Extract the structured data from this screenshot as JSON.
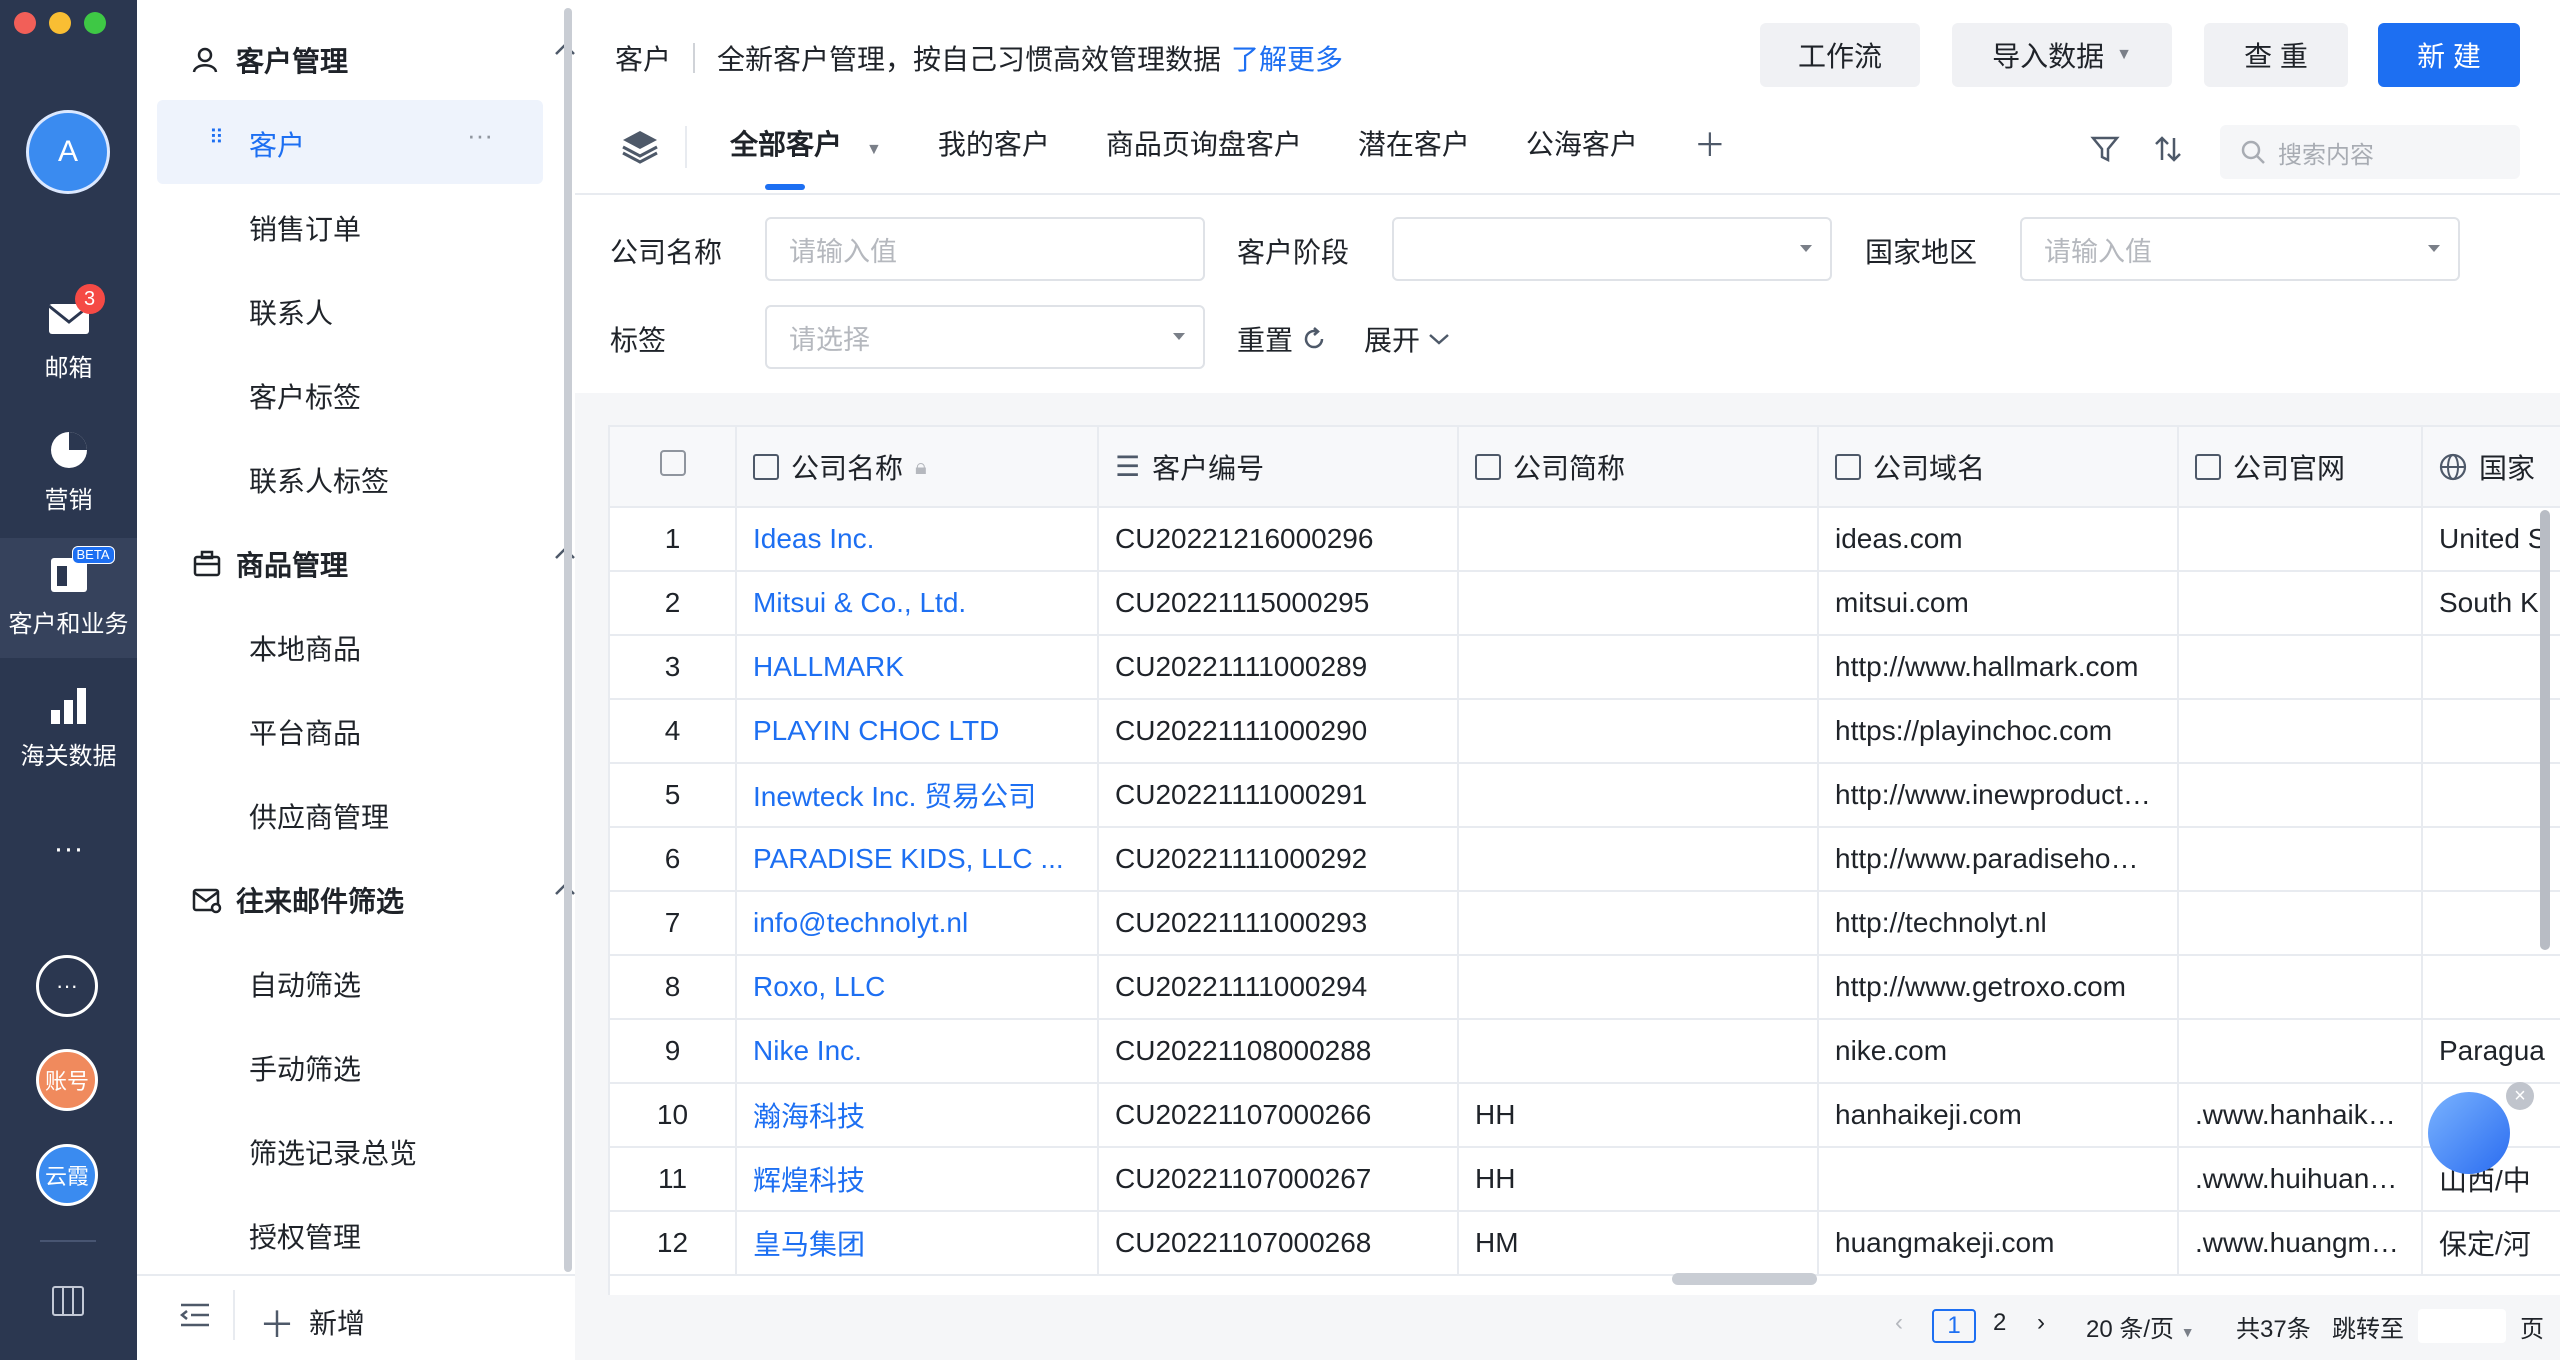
{
  "rail": {
    "avatar": "A",
    "items": [
      {
        "label": "邮箱",
        "badge": "3"
      },
      {
        "label": "营销"
      },
      {
        "label": "客户和业务",
        "tag": "BETA"
      },
      {
        "label": "海关数据"
      }
    ],
    "more": "···",
    "account": "账号",
    "cloud": "云霞"
  },
  "sidebar": {
    "groups": [
      {
        "title": "客户管理",
        "items": [
          "客户",
          "销售订单",
          "联系人",
          "客户标签",
          "联系人标签"
        ]
      },
      {
        "title": "商品管理",
        "items": [
          "本地商品",
          "平台商品",
          "供应商管理"
        ]
      },
      {
        "title": "往来邮件筛选",
        "items": [
          "自动筛选",
          "手动筛选",
          "筛选记录总览",
          "授权管理"
        ]
      }
    ],
    "active_more": "···",
    "add_label": "新增"
  },
  "header": {
    "title": "客户",
    "description": "全新客户管理，按自己习惯高效管理数据",
    "learn_more": "了解更多",
    "buttons": {
      "workflow": "工作流",
      "import": "导入数据",
      "dedupe": "查 重",
      "create": "新 建"
    }
  },
  "tabs": [
    "全部客户",
    "我的客户",
    "商品页询盘客户",
    "潜在客户",
    "公海客户"
  ],
  "search": {
    "placeholder": "搜索内容"
  },
  "filters": {
    "company_label": "公司名称",
    "company_placeholder": "请输入值",
    "stage_label": "客户阶段",
    "country_label": "国家地区",
    "country_placeholder": "请输入值",
    "tag_label": "标签",
    "tag_placeholder": "请选择",
    "reset": "重置",
    "expand": "展开"
  },
  "table": {
    "columns": [
      "公司名称",
      "客户编号",
      "公司简称",
      "公司域名",
      "公司官网",
      "国家"
    ],
    "rows": [
      {
        "no": "1",
        "name": "Ideas Inc.",
        "code": "CU20221216000296",
        "short": "",
        "domain": "ideas.com",
        "site": "",
        "country": "United S"
      },
      {
        "no": "2",
        "name": "Mitsui & Co., Ltd.",
        "code": "CU20221115000295",
        "short": "",
        "domain": "mitsui.com",
        "site": "",
        "country": "South K"
      },
      {
        "no": "3",
        "name": "HALLMARK",
        "code": "CU20221111000289",
        "short": "",
        "domain": "http://www.hallmark.com",
        "site": "",
        "country": ""
      },
      {
        "no": "4",
        "name": "PLAYIN CHOC LTD",
        "code": "CU20221111000290",
        "short": "",
        "domain": "https://playinchoc.com",
        "site": "",
        "country": ""
      },
      {
        "no": "5",
        "name": "Inewteck Inc. 贸易公司",
        "code": "CU20221111000291",
        "short": "",
        "domain": "http://www.inewproducts.com",
        "site": "",
        "country": ""
      },
      {
        "no": "6",
        "name": "PARADISE KIDS, LLC ...",
        "code": "CU20221111000292",
        "short": "",
        "domain": "http://www.paradisehome.com",
        "site": "",
        "country": ""
      },
      {
        "no": "7",
        "name": "info@technolyt.nl",
        "code": "CU20221111000293",
        "short": "",
        "domain": "http://technolyt.nl",
        "site": "",
        "country": ""
      },
      {
        "no": "8",
        "name": "Roxo, LLC",
        "code": "CU20221111000294",
        "short": "",
        "domain": "http://www.getroxo.com",
        "site": "",
        "country": ""
      },
      {
        "no": "9",
        "name": "Nike Inc.",
        "code": "CU20221108000288",
        "short": "",
        "domain": "nike.com",
        "site": "",
        "country": "Paragua"
      },
      {
        "no": "10",
        "name": "瀚海科技",
        "code": "CU20221107000266",
        "short": "HH",
        "domain": "hanhaikeji.com",
        "site": ".www.hanhaikeji.com",
        "country": "中"
      },
      {
        "no": "11",
        "name": "辉煌科技",
        "code": "CU20221107000267",
        "short": "HH",
        "domain": "",
        "site": ".www.huihuang.com",
        "country": "山西/中"
      },
      {
        "no": "12",
        "name": "皇马集团",
        "code": "CU20221107000268",
        "short": "HM",
        "domain": "huangmakeji.com",
        "site": ".www.huangmakeji.com",
        "country": "保定/河"
      }
    ]
  },
  "pager": {
    "page1": "1",
    "page2": "2",
    "per_page": "20 条/页",
    "total": "共37条",
    "jump": "跳转至",
    "unit": "页"
  },
  "colors": {
    "accent": "#1d6ff2",
    "rail": "#2b3750"
  }
}
